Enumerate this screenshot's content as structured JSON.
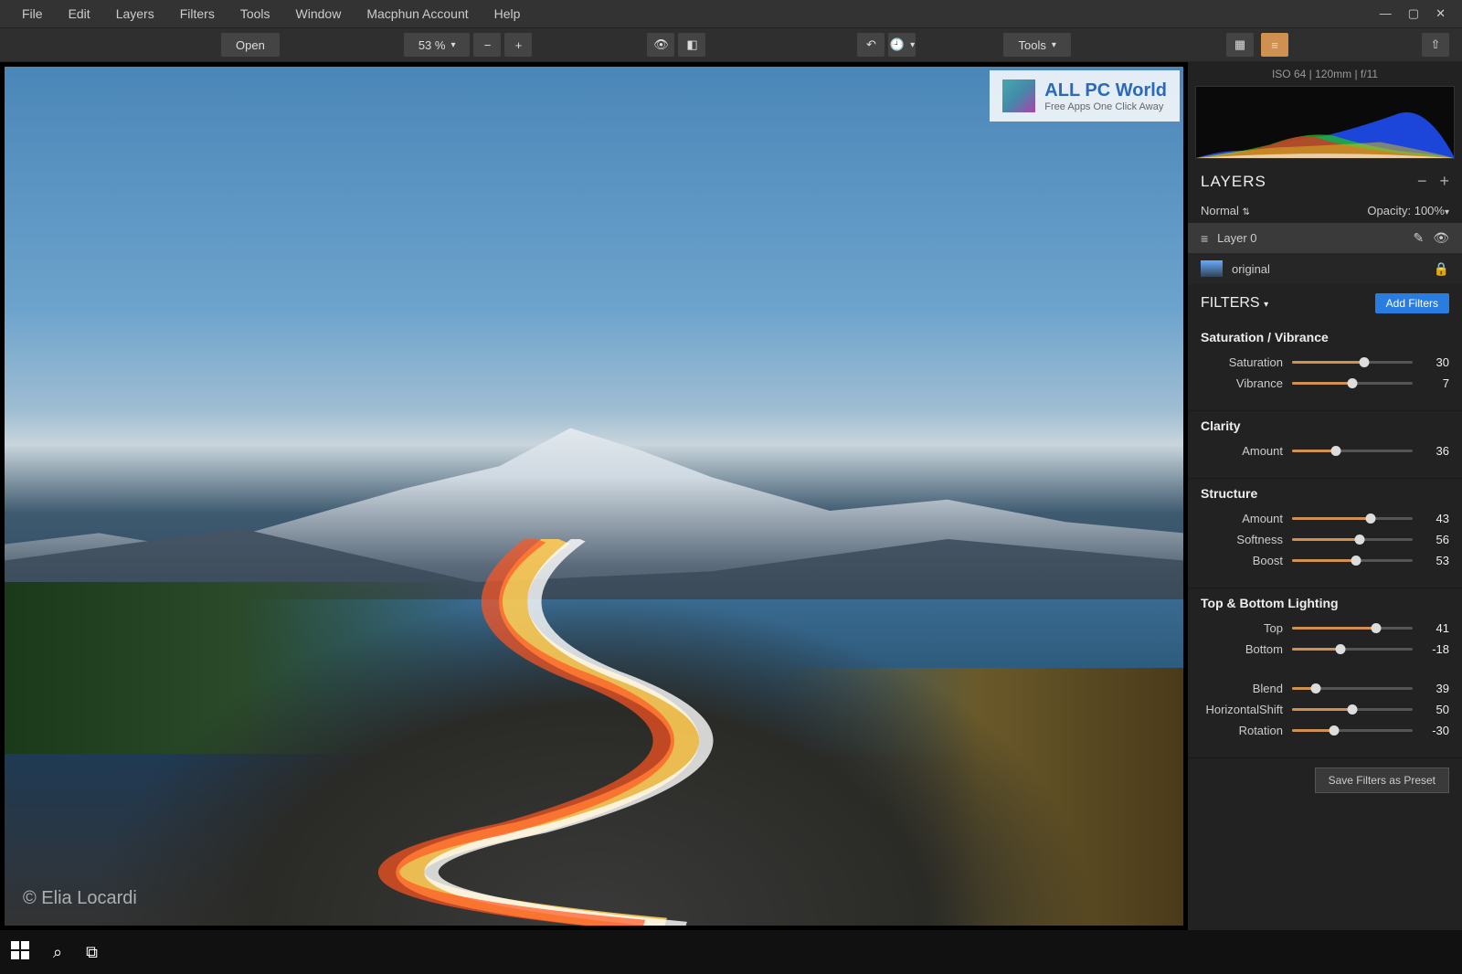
{
  "menu": {
    "file": "File",
    "edit": "Edit",
    "layers": "Layers",
    "filters": "Filters",
    "tools": "Tools",
    "window": "Window",
    "account": "Macphun Account",
    "help": "Help"
  },
  "toolbar": {
    "open": "Open",
    "zoom": "53 %",
    "tools": "Tools"
  },
  "meta": {
    "info": "ISO 64 | 120mm | f/11"
  },
  "layers_panel": {
    "title": "LAYERS",
    "blend": "Normal",
    "opacity_lbl": "Opacity:",
    "opacity_val": "100%",
    "layer0": "Layer 0",
    "original": "original"
  },
  "filters_panel": {
    "title": "FILTERS",
    "add": "Add Filters",
    "save_preset": "Save Filters as Preset"
  },
  "filters": {
    "satvib": {
      "title": "Saturation / Vibrance",
      "saturation": {
        "lbl": "Saturation",
        "val": 30,
        "pct": 60
      },
      "vibrance": {
        "lbl": "Vibrance",
        "val": 7,
        "pct": 50
      }
    },
    "clarity": {
      "title": "Clarity",
      "amount": {
        "lbl": "Amount",
        "val": 36,
        "pct": 36
      }
    },
    "structure": {
      "title": "Structure",
      "amount": {
        "lbl": "Amount",
        "val": 43,
        "pct": 65
      },
      "softness": {
        "lbl": "Softness",
        "val": 56,
        "pct": 56
      },
      "boost": {
        "lbl": "Boost",
        "val": 53,
        "pct": 53
      }
    },
    "topbot": {
      "title": "Top & Bottom Lighting",
      "top": {
        "lbl": "Top",
        "val": 41,
        "pct": 70
      },
      "bottom": {
        "lbl": "Bottom",
        "val": -18,
        "pct": 40
      },
      "blend": {
        "lbl": "Blend",
        "val": 39,
        "pct": 20
      },
      "hshift": {
        "lbl": "HorizontalShift",
        "val": 50,
        "pct": 50
      },
      "rotation": {
        "lbl": "Rotation",
        "val": -30,
        "pct": 35
      }
    }
  },
  "credit": "© Elia Locardi",
  "watermark": {
    "t1": "ALL PC World",
    "t2": "Free Apps One Click Away"
  }
}
